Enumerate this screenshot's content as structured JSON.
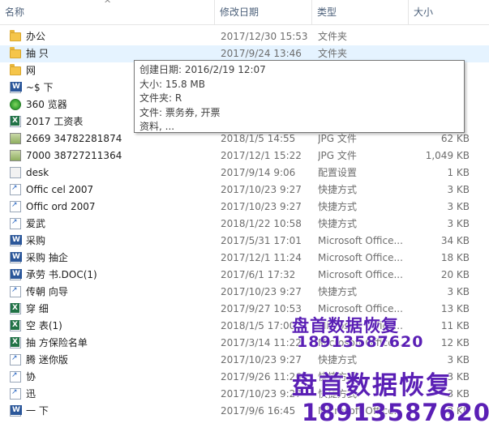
{
  "columns": {
    "name": "名称",
    "date": "修改日期",
    "type": "类型",
    "size": "大小"
  },
  "rows": [
    {
      "icon": "folder",
      "name": "办公",
      "date": "2017/12/30 15:53",
      "type": "文件夹",
      "size": ""
    },
    {
      "icon": "folder",
      "name": "抽          只",
      "date": "2017/9/24 13:46",
      "type": "文件夹",
      "size": "",
      "selected": true
    },
    {
      "icon": "folder",
      "name": "网",
      "date": "",
      "type": "",
      "size": ""
    },
    {
      "icon": "doc",
      "name": "~$        下",
      "date": "",
      "type": "",
      "size": ""
    },
    {
      "icon": "browser",
      "name": "360         览器",
      "date": "",
      "type": "",
      "size": ""
    },
    {
      "icon": "xls",
      "name": "2017         工资表",
      "date": "",
      "type": "",
      "size": ""
    },
    {
      "icon": "img",
      "name": "2669      34782281874",
      "date": "2018/1/5 14:55",
      "type": "JPG 文件",
      "size": "62 KB"
    },
    {
      "icon": "img",
      "name": "7000      38727211364",
      "date": "2017/12/1 15:22",
      "type": "JPG 文件",
      "size": "1,049 KB"
    },
    {
      "icon": "cfg",
      "name": "desk",
      "date": "2017/9/14 9:06",
      "type": "配置设置",
      "size": "1 KB"
    },
    {
      "icon": "lnk",
      "name": "Offic      cel 2007",
      "date": "2017/10/23 9:27",
      "type": "快捷方式",
      "size": "3 KB"
    },
    {
      "icon": "lnk",
      "name": "Offic      ord 2007",
      "date": "2017/10/23 9:27",
      "type": "快捷方式",
      "size": "3 KB"
    },
    {
      "icon": "lnk",
      "name": "爱武",
      "date": "2018/1/22 10:58",
      "type": "快捷方式",
      "size": "3 KB"
    },
    {
      "icon": "doc",
      "name": "采购",
      "date": "2017/5/31 17:01",
      "type": "Microsoft Office...",
      "size": "34 KB"
    },
    {
      "icon": "doc",
      "name": "采购      抽企",
      "date": "2017/12/1 11:24",
      "type": "Microsoft Office...",
      "size": "18 KB"
    },
    {
      "icon": "doc",
      "name": "承劳        书.DOC(1)",
      "date": "2017/6/1 17:32",
      "type": "Microsoft Office...",
      "size": "20 KB"
    },
    {
      "icon": "lnk",
      "name": "传朝        向导",
      "date": "2017/10/23 9:27",
      "type": "快捷方式",
      "size": "3 KB"
    },
    {
      "icon": "xls",
      "name": "穿          细",
      "date": "2017/9/27 10:53",
      "type": "Microsoft Office...",
      "size": "13 KB"
    },
    {
      "icon": "xls",
      "name": "空        表(1)",
      "date": "2018/1/5 17:00",
      "type": "Microsoft Office...",
      "size": "11 KB"
    },
    {
      "icon": "xls",
      "name": "抽        方保险名单",
      "date": "2017/3/14 11:22",
      "type": "Microsoft Office...",
      "size": "12 KB"
    },
    {
      "icon": "lnk",
      "name": "腾        迷你版",
      "date": "2017/10/23 9:27",
      "type": "快捷方式",
      "size": "3 KB"
    },
    {
      "icon": "lnk",
      "name": "协",
      "date": "2017/9/26 11:26",
      "type": "快捷方式",
      "size": "3 KB"
    },
    {
      "icon": "lnk",
      "name": "迅",
      "date": "2017/10/23 9:27",
      "type": "快捷方式",
      "size": "3 KB"
    },
    {
      "icon": "doc",
      "name": "一        下",
      "date": "2017/9/6 16:45",
      "type": "Microsoft Office...",
      "size": "2 KB"
    }
  ],
  "tooltip": {
    "line1": "创建日期: 2016/2/19 12:07",
    "line2": "大小: 15.8 MB",
    "line3": "文件夹: R",
    "line4": "文件:                                                             票务券, 开票",
    "line5": "资料, ..."
  },
  "watermarks": {
    "wm1": "盘首数据恢复",
    "wm2": "18913587620",
    "wm3": "盘首数据恢复",
    "wm4": "18913587620"
  },
  "colors": {
    "selection": "#e5f3ff",
    "watermark": "#5a1fb5"
  }
}
